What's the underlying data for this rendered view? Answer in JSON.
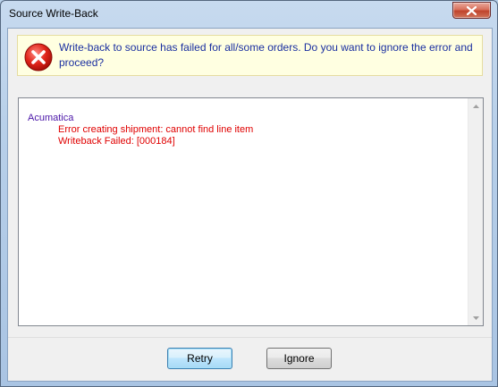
{
  "window": {
    "title": "Source Write-Back"
  },
  "titlebar": {
    "close_icon": "close-icon"
  },
  "banner": {
    "icon": "error-icon",
    "message": "Write-back to source has failed for all/some orders. Do you want to ignore the error and proceed?"
  },
  "log": {
    "source": "Acumatica",
    "lines": [
      "Error creating shipment: cannot find line item",
      "Writeback Failed: [000184]"
    ]
  },
  "buttons": {
    "retry_label": "Retry",
    "ignore_label": "Ignore"
  },
  "colors": {
    "banner_text": "#1a2fa0",
    "log_source": "#4b16a8",
    "log_error": "#e00000",
    "banner_background": "#ffffe1"
  }
}
